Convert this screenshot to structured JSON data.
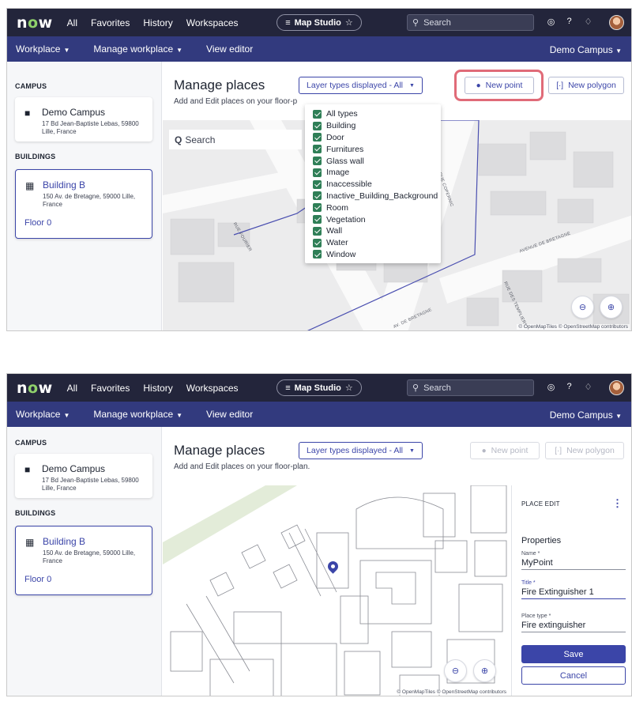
{
  "topnav": {
    "logo_n": "n",
    "logo_o": "o",
    "logo_w": "w",
    "links": [
      "All",
      "Favorites",
      "History",
      "Workspaces"
    ],
    "studio_label": "Map Studio",
    "search_placeholder": "Search",
    "icons": [
      "globe-icon",
      "help-icon",
      "bell-icon"
    ]
  },
  "subnav": {
    "workplace": "Workplace",
    "manage_workplace": "Manage workplace",
    "view_editor": "View editor",
    "campus_selector": "Demo Campus"
  },
  "sidebar": {
    "campus_heading": "CAMPUS",
    "campus": {
      "name": "Demo Campus",
      "address": "17 Bd Jean-Baptiste Lebas, 59800 Lille, France"
    },
    "buildings_heading": "BUILDINGS",
    "building": {
      "name": "Building B",
      "address": "150 Av. de Bretagne, 59000 Lille, France",
      "floor": "Floor 0"
    }
  },
  "main": {
    "title": "Manage places",
    "subtitle": "Add and Edit places on your floor-plan.",
    "subtitle_cut": "Add and Edit places on your floor-p",
    "layer_button": "Layer types displayed - All",
    "new_point": "New point",
    "new_polygon": "New polygon",
    "map_search": "Search",
    "attribution": "© OpenMapTiles © OpenStreetMap contributors"
  },
  "streets": {
    "fourier": "RUE FOURIER",
    "copernic": "RUE COPERNIC",
    "avenue": "AVENUE DE BRETAGNE",
    "temp": "RUE DES TEMPLIERS",
    "bretagne": "AV. DE BRETAGNE"
  },
  "dropdown": {
    "items": [
      "All types",
      "Building",
      "Door",
      "Furnitures",
      "Glass wall",
      "Image",
      "Inaccessible",
      "Inactive_Building_Background",
      "Room",
      "Vegetation",
      "Wall",
      "Water",
      "Window"
    ]
  },
  "place_edit": {
    "heading": "PLACE EDIT",
    "section": "Properties",
    "name_label": "Name *",
    "name_value": "MyPoint",
    "title_label": "Title *",
    "title_value": "Fire Extinguisher 1",
    "type_label": "Place type *",
    "type_value": "Fire extinguisher",
    "save": "Save",
    "cancel": "Cancel"
  },
  "colors": {
    "topnav_bg": "#23253b",
    "subnav_bg": "#323a7e",
    "accent": "#3b45a8",
    "highlight": "#e06b78",
    "checkbox": "#2f7f57",
    "logo_o": "#8fd16b"
  }
}
